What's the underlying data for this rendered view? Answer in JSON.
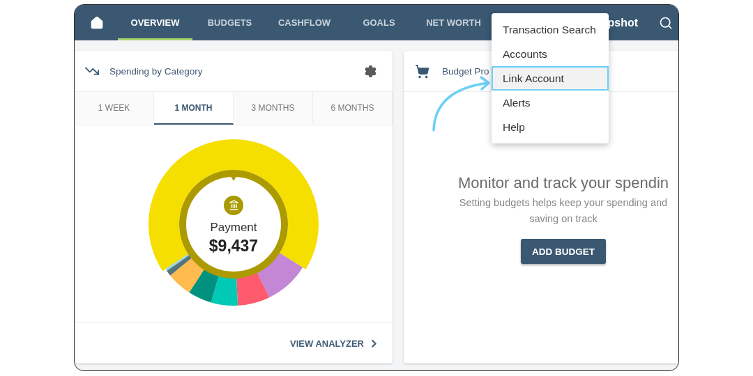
{
  "nav": {
    "items": [
      {
        "label": "OVERVIEW",
        "selected": true
      },
      {
        "label": "BUDGETS",
        "selected": false
      },
      {
        "label": "CASHFLOW",
        "selected": false
      },
      {
        "label": "GOALS",
        "selected": false
      },
      {
        "label": "NET WORTH",
        "selected": false
      }
    ],
    "brand_fragment": "pshot"
  },
  "menu": {
    "items": [
      {
        "label": "Transaction Search",
        "selected": false
      },
      {
        "label": "Accounts",
        "selected": false
      },
      {
        "label": "Link Account",
        "selected": true
      },
      {
        "label": "Alerts",
        "selected": false
      },
      {
        "label": "Help",
        "selected": false
      }
    ]
  },
  "spending_card": {
    "title": "Spending by Category",
    "tabs": [
      {
        "label": "1 WEEK",
        "selected": false
      },
      {
        "label": "1 MONTH",
        "selected": true
      },
      {
        "label": "3 MONTHS",
        "selected": false
      },
      {
        "label": "6 MONTHS",
        "selected": false
      }
    ],
    "center_label": "Payment",
    "center_amount": "$9,437",
    "footer_link": "VIEW ANALYZER"
  },
  "budget_card": {
    "title": "Budget Pro",
    "heading": "Monitor and track your spendin",
    "description": "Setting budgets helps keep your spending and saving on track",
    "button": "ADD BUDGET"
  }
}
